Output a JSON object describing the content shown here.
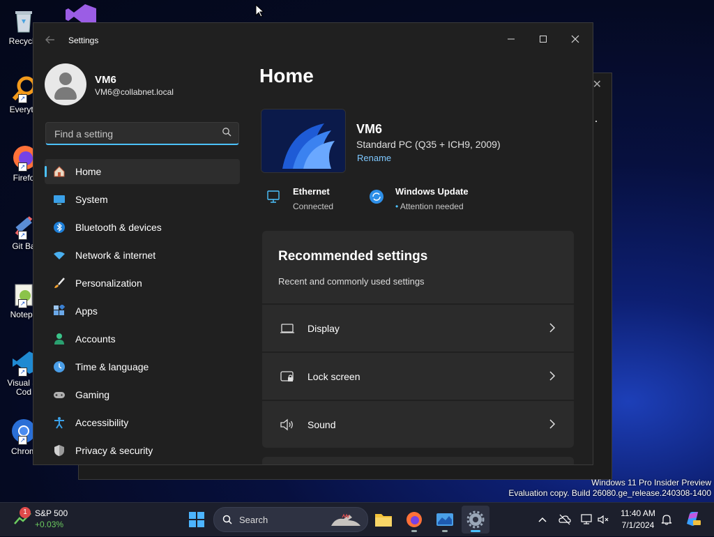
{
  "desktop": {
    "icons": [
      {
        "label": "Recycle"
      },
      {
        "label": "Everyth"
      },
      {
        "label": "Firefo"
      },
      {
        "label": "Git Ba"
      },
      {
        "label": "Notepa"
      },
      {
        "label": "Visual St",
        "label2": "Cod"
      },
      {
        "label": "Chrom"
      }
    ],
    "watermark": {
      "line1": "Windows 11 Pro Insider Preview",
      "line2": "Evaluation copy. Build 26080.ge_release.240308-1400"
    }
  },
  "settings": {
    "app_title": "Settings",
    "profile": {
      "name": "VM6",
      "email": "VM6@collabnet.local"
    },
    "search": {
      "placeholder": "Find a setting"
    },
    "nav": [
      {
        "label": "Home",
        "icon": "home-icon",
        "active": true
      },
      {
        "label": "System",
        "icon": "system-icon"
      },
      {
        "label": "Bluetooth & devices",
        "icon": "bluetooth-icon"
      },
      {
        "label": "Network & internet",
        "icon": "network-icon"
      },
      {
        "label": "Personalization",
        "icon": "brush-icon"
      },
      {
        "label": "Apps",
        "icon": "apps-icon"
      },
      {
        "label": "Accounts",
        "icon": "accounts-icon"
      },
      {
        "label": "Time & language",
        "icon": "clock-globe-icon"
      },
      {
        "label": "Gaming",
        "icon": "gamepad-icon"
      },
      {
        "label": "Accessibility",
        "icon": "accessibility-icon"
      },
      {
        "label": "Privacy & security",
        "icon": "shield-icon"
      }
    ],
    "home": {
      "title": "Home",
      "device": {
        "name": "VM6",
        "model": "Standard PC (Q35 + ICH9, 2009)",
        "rename": "Rename"
      },
      "ethernet": {
        "title": "Ethernet",
        "status": "Connected"
      },
      "update": {
        "title": "Windows Update",
        "status": "Attention needed"
      },
      "recommended": {
        "title": "Recommended settings",
        "subtitle": "Recent and commonly used settings",
        "items": [
          {
            "label": "Display",
            "icon": "display-icon"
          },
          {
            "label": "Lock screen",
            "icon": "lock-screen-icon"
          },
          {
            "label": "Sound",
            "icon": "sound-icon"
          }
        ]
      }
    }
  },
  "taskbar": {
    "stock": {
      "badge": "1",
      "name": "S&P 500",
      "change": "+0.03%"
    },
    "search_label": "Search",
    "clock": {
      "time": "11:40 AM",
      "date": "7/1/2024"
    }
  },
  "colors": {
    "accent": "#4cc2ff",
    "window_bg": "#202020",
    "card_bg": "#2b2b2b"
  }
}
